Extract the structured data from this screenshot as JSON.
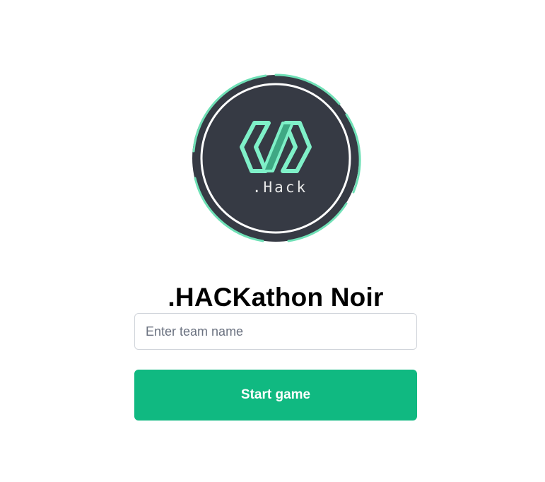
{
  "logo": {
    "text": ".Hack",
    "colors": {
      "disc": "#363a44",
      "ring_outer": "#6fe0b6",
      "ring_inner": "#ffffff",
      "mark": "#7ff0c8",
      "mark_dark": "#3fa884",
      "text": "#e8e8e8"
    }
  },
  "page": {
    "title": ".HACKathon Noir"
  },
  "form": {
    "team_name_placeholder": "Enter team name",
    "team_name_value": "",
    "start_label": "Start game"
  },
  "colors": {
    "accent": "#10b981",
    "input_border": "#d1d5db",
    "placeholder": "#6b7280"
  }
}
